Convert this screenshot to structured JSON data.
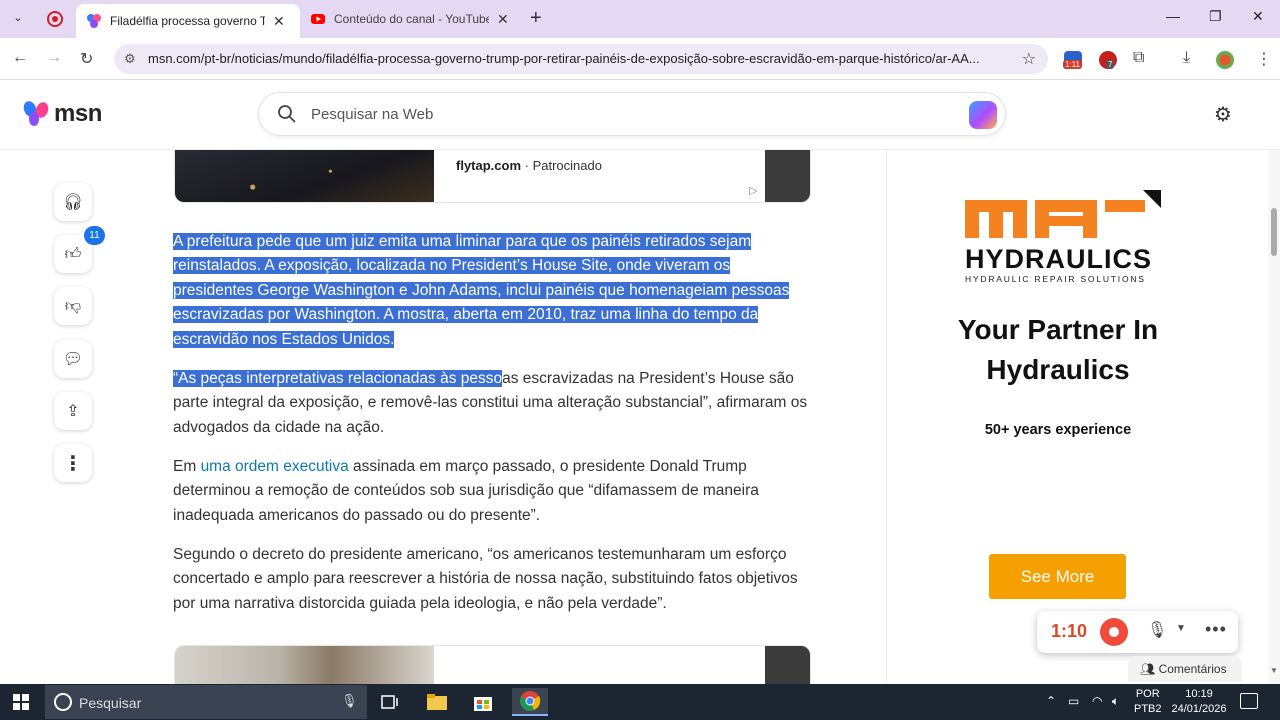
{
  "browser": {
    "tabs": [
      {
        "title": "Filadélfia processa governo Trump",
        "active": true
      },
      {
        "title": "Conteúdo do canal - YouTube Studio",
        "active": false
      }
    ],
    "url": "msn.com/pt-br/noticias/mundo/filadélfia-processa-governo-trump-por-retirar-painéis-de-exposição-sobre-escravidão-em-parque-histórico/ar-AA...",
    "extension_badges": {
      "timer": "1:11",
      "count": "7"
    }
  },
  "msn": {
    "logo_text": "msn",
    "search_placeholder": "Pesquisar na Web"
  },
  "rail": {
    "like_count": "11"
  },
  "ad_top": {
    "source": "flytap.com",
    "label": "Patrocinado"
  },
  "article": {
    "p1": "A prefeitura pede que um juiz emita uma liminar para que os painéis retirados sejam reinstalados. A exposição, localizada no President’s House Site, onde viveram os presidentes George Washington e John Adams, inclui painéis que homenageiam pessoas escravizadas por Washington. A mostra, aberta em 2010, traz uma linha do tempo da escravidão nos Estados Unidos.",
    "p2_highlight": "“As peças interpretativas relacionadas às pesso",
    "p2_rest": "as escravizadas na President’s House são parte integral da exposição, e removê-las constitui uma alteração substancial”, afirmaram os advogados da cidade na ação.",
    "p3_before": "Em ",
    "p3_link": "uma ordem executiva",
    "p3_after": " assinada em março passado, o presidente Donald Trump determinou a remoção de conteúdos sob sua jurisdição que “difamassem de maneira inadequada americanos do passado ou do presente”.",
    "p4": "Segundo o decreto do presidente americano, “os americanos testemunharam um esforço concertado e amplo para reescrever a história de nossa nação, substituindo fatos objetivos por uma narrativa distorcida guiada pela ideologia, e não pela verdade”."
  },
  "side_ad": {
    "brand": "HYDRAULICS",
    "tagline": "HYDRAULIC REPAIR SOLUTIONS",
    "headline": "Your Partner In Hydraulics",
    "experience": "50+ years experience",
    "cta": "See More",
    "brand_color": "#f58220"
  },
  "recorder": {
    "time": "1:10"
  },
  "comments_label": "Comentários",
  "taskbar": {
    "search_placeholder": "Pesquisar",
    "lang_top": "POR",
    "lang_bottom": "PTB2",
    "time": "10:19",
    "date": "24/01/2026"
  }
}
